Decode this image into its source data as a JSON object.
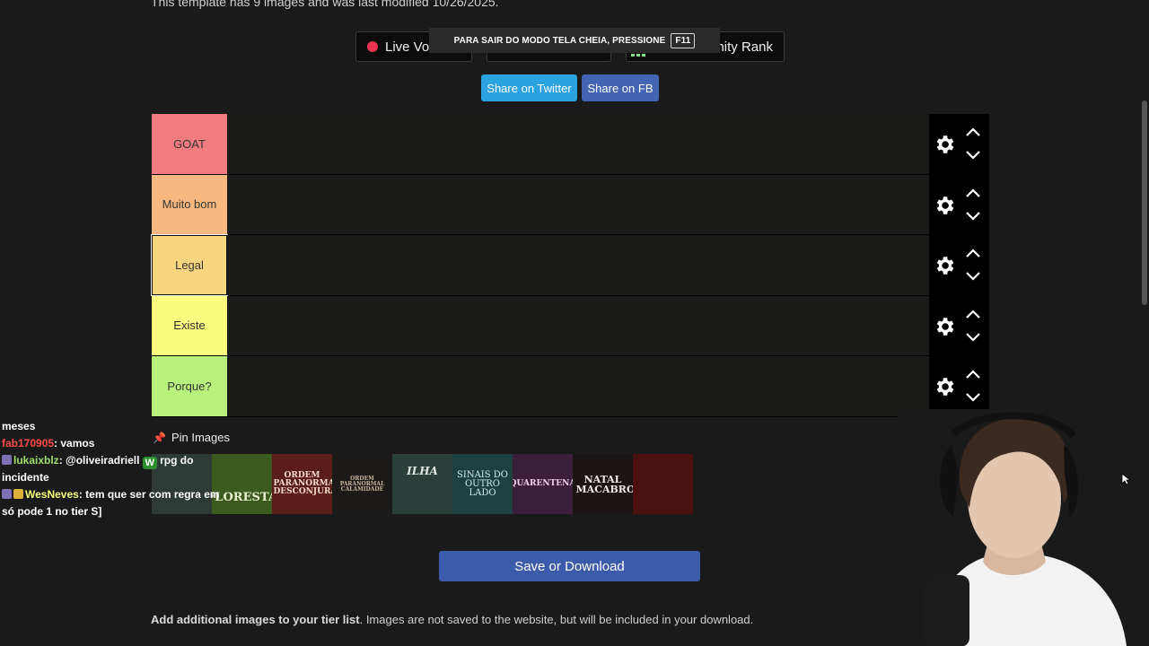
{
  "template_info": "This template has 9 images and was last modified 10/26/2025.",
  "top_buttons": {
    "live_voting": "Live Voti",
    "middle": "",
    "community_rank": "unity Rank"
  },
  "fullscreen_banner": {
    "text": "PARA SAIR DO MODO TELA CHEIA, PRESSIONE",
    "key": "F11"
  },
  "share": {
    "twitter": "Share on Twitter",
    "facebook": "Share on FB"
  },
  "tiers": [
    {
      "label": "GOAT",
      "color": "#f07b80"
    },
    {
      "label": "Muito bom",
      "color": "#f7b97f"
    },
    {
      "label": "Legal",
      "color": "#f8d67f"
    },
    {
      "label": "Existe",
      "color": "#fafb7f"
    },
    {
      "label": "Porque?",
      "color": "#b8f07c"
    }
  ],
  "pin_images": "Pin Images",
  "images": [
    {
      "text": "",
      "bg": "#2d3a36"
    },
    {
      "text": "FLORESTA",
      "bg": "#3b5a1d"
    },
    {
      "text": "ORDEM PARANORMAL DESCONJURAÇÃO",
      "bg": "#5a1d1a"
    },
    {
      "text": "ORDEM PARANORMAL CALAMIDADE",
      "bg": "#1c1a18"
    },
    {
      "text": "ILHA",
      "bg": "#2a3f3a"
    },
    {
      "text": "SINAIS DO OUTRO LADO",
      "bg": "#1d4040"
    },
    {
      "text": "QUARENTENA",
      "bg": "#3a1e3a"
    },
    {
      "text": "NATAL MACABRO",
      "bg": "#1a1414"
    },
    {
      "text": "",
      "bg": "#4a1010"
    }
  ],
  "chat": {
    "line1": "meses",
    "msg2_user": "fab170905",
    "msg2_text": ": vamos",
    "msg3_user": "lukaixblz",
    "msg3_text": ": @oliveiradriell",
    "msg3_after": "rpg do incidente",
    "msg4_user": "WesNeves",
    "msg4_text": ": tem que ser com regra em só pode 1 no tier S]"
  },
  "save_button": "Save or Download",
  "add_images": {
    "bold": "Add additional images to your tier list",
    "rest": ". Images are not saved to the website, but will be included in your download."
  }
}
